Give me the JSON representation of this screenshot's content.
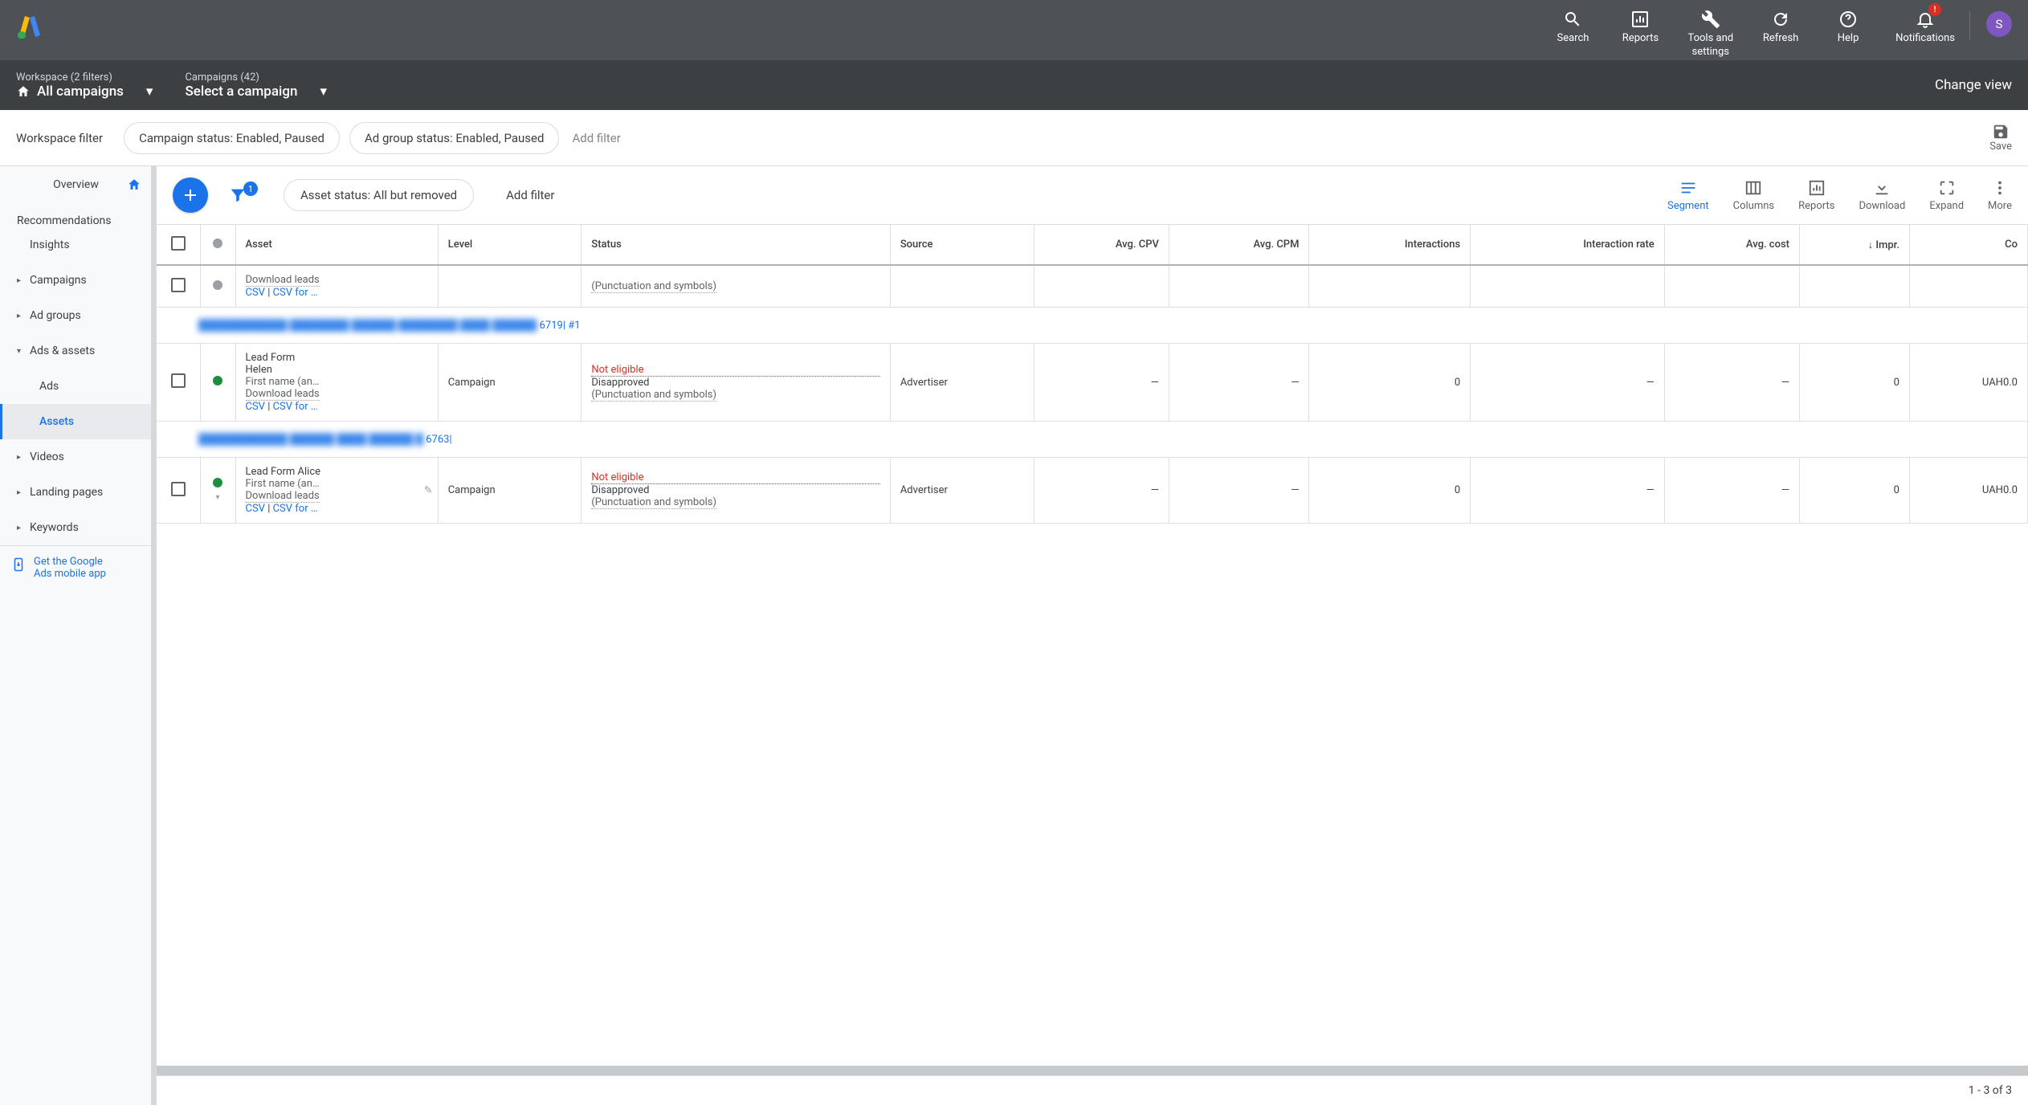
{
  "header": {
    "actions": [
      {
        "icon": "search",
        "label": "Search"
      },
      {
        "icon": "bar-chart",
        "label": "Reports"
      },
      {
        "icon": "wrench",
        "label": "Tools and\nsettings"
      },
      {
        "icon": "refresh",
        "label": "Refresh"
      },
      {
        "icon": "help",
        "label": "Help"
      },
      {
        "icon": "bell",
        "label": "Notifications",
        "badge": "!"
      }
    ],
    "avatar": "S"
  },
  "subheader": {
    "workspace": {
      "top": "Workspace (2 filters)",
      "bottom": "All campaigns"
    },
    "campaigns": {
      "top": "Campaigns (42)",
      "bottom": "Select a campaign"
    },
    "change_view": "Change view"
  },
  "filterbar": {
    "label": "Workspace filter",
    "chips": [
      "Campaign status: Enabled, Paused",
      "Ad group status: Enabled, Paused"
    ],
    "add_filter": "Add filter",
    "save": "Save"
  },
  "sidebar": {
    "items": [
      {
        "label": "Overview",
        "icon": "home"
      },
      {
        "label": "Recommendations",
        "dot": true
      },
      {
        "label": "Insights"
      },
      {
        "label": "Campaigns",
        "arrow": true
      },
      {
        "label": "Ad groups",
        "arrow": true
      },
      {
        "label": "Ads & assets",
        "arrow": true,
        "expanded": true,
        "children": [
          {
            "label": "Ads"
          },
          {
            "label": "Assets",
            "active": true
          }
        ]
      },
      {
        "label": "Videos",
        "arrow": true
      },
      {
        "label": "Landing pages",
        "arrow": true
      },
      {
        "label": "Keywords",
        "arrow": true
      }
    ],
    "promo": "Get the Google\nAds mobile app"
  },
  "toolbar": {
    "filter_count": "1",
    "chip": "Asset status: All but removed",
    "add_filter": "Add filter",
    "actions": [
      {
        "label": "Segment",
        "active": true,
        "icon": "segment"
      },
      {
        "label": "Columns",
        "icon": "columns"
      },
      {
        "label": "Reports",
        "icon": "report"
      },
      {
        "label": "Download",
        "icon": "download"
      },
      {
        "label": "Expand",
        "icon": "expand"
      },
      {
        "label": "More",
        "icon": "more"
      }
    ]
  },
  "table": {
    "columns": [
      "",
      "",
      "Asset",
      "Level",
      "Status",
      "Source",
      "Avg. CPV",
      "Avg. CPM",
      "Interactions",
      "Interaction rate",
      "Avg. cost",
      "Impr.",
      "Co"
    ],
    "sort_col": "Impr.",
    "rows": [
      {
        "type": "partial",
        "status_dot": "gray",
        "asset_sub": "Download leads",
        "asset_links": [
          "CSV",
          "CSV for …"
        ],
        "status_top": "",
        "status_detail": "(Punctuation and symbols)"
      },
      {
        "type": "group",
        "label_blurred": "████████████ ████████ ██████ ████████ ████ ██████",
        "label_suffix": "6719| #1"
      },
      {
        "type": "data",
        "status_dot": "green",
        "asset_title": "Lead Form",
        "asset_name": "Helen",
        "asset_fields": "First name (an…",
        "asset_sub": "Download leads",
        "asset_links": [
          "CSV",
          "CSV for …"
        ],
        "level": "Campaign",
        "status_top": "Not eligible",
        "status_main": "Disapproved",
        "status_detail": "(Punctuation and symbols)",
        "source": "Advertiser",
        "avg_cpv": "—",
        "avg_cpm": "—",
        "interactions": "0",
        "interaction_rate": "—",
        "avg_cost": "—",
        "impr": "0",
        "cost": "UAH0.0"
      },
      {
        "type": "group",
        "label_blurred": "████████████ ██████ ████ ██████ █",
        "label_suffix": "6763|"
      },
      {
        "type": "data",
        "status_dot": "green",
        "status_caret": true,
        "editable": true,
        "asset_title": "Lead Form Alice",
        "asset_fields": "First name (an…",
        "asset_sub": "Download leads",
        "asset_links": [
          "CSV",
          "CSV for …"
        ],
        "level": "Campaign",
        "status_top": "Not eligible",
        "status_main": "Disapproved",
        "status_detail": "(Punctuation and symbols)",
        "source": "Advertiser",
        "avg_cpv": "—",
        "avg_cpm": "—",
        "interactions": "0",
        "interaction_rate": "—",
        "avg_cost": "—",
        "impr": "0",
        "cost": "UAH0.0"
      }
    ]
  },
  "footer": {
    "pagination": "1 - 3 of 3"
  }
}
